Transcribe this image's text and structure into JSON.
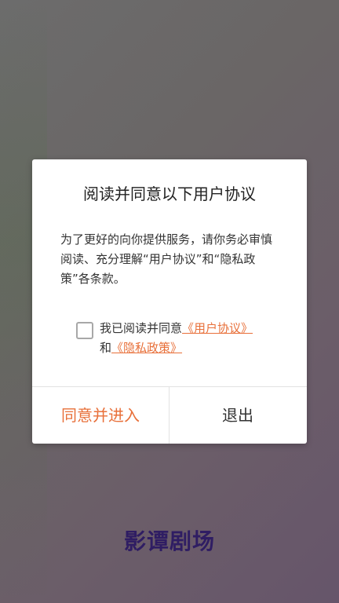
{
  "dialog": {
    "title": "阅读并同意以下用户协议",
    "body": "为了更好的向你提供服务，请你务必审慎阅读、充分理解“用户协议”和“隐私政策”各条款。",
    "agree_prefix": "我已阅读并同意",
    "user_agreement_link": "《用户协议》",
    "and_text": "和",
    "privacy_policy_link": "《隐私政策》",
    "agree_button": "同意并进入",
    "exit_button": "退出"
  },
  "app": {
    "logo_text": "影谭剧场"
  },
  "colors": {
    "accent": "#e8703a",
    "logo": "#2f1d63"
  }
}
